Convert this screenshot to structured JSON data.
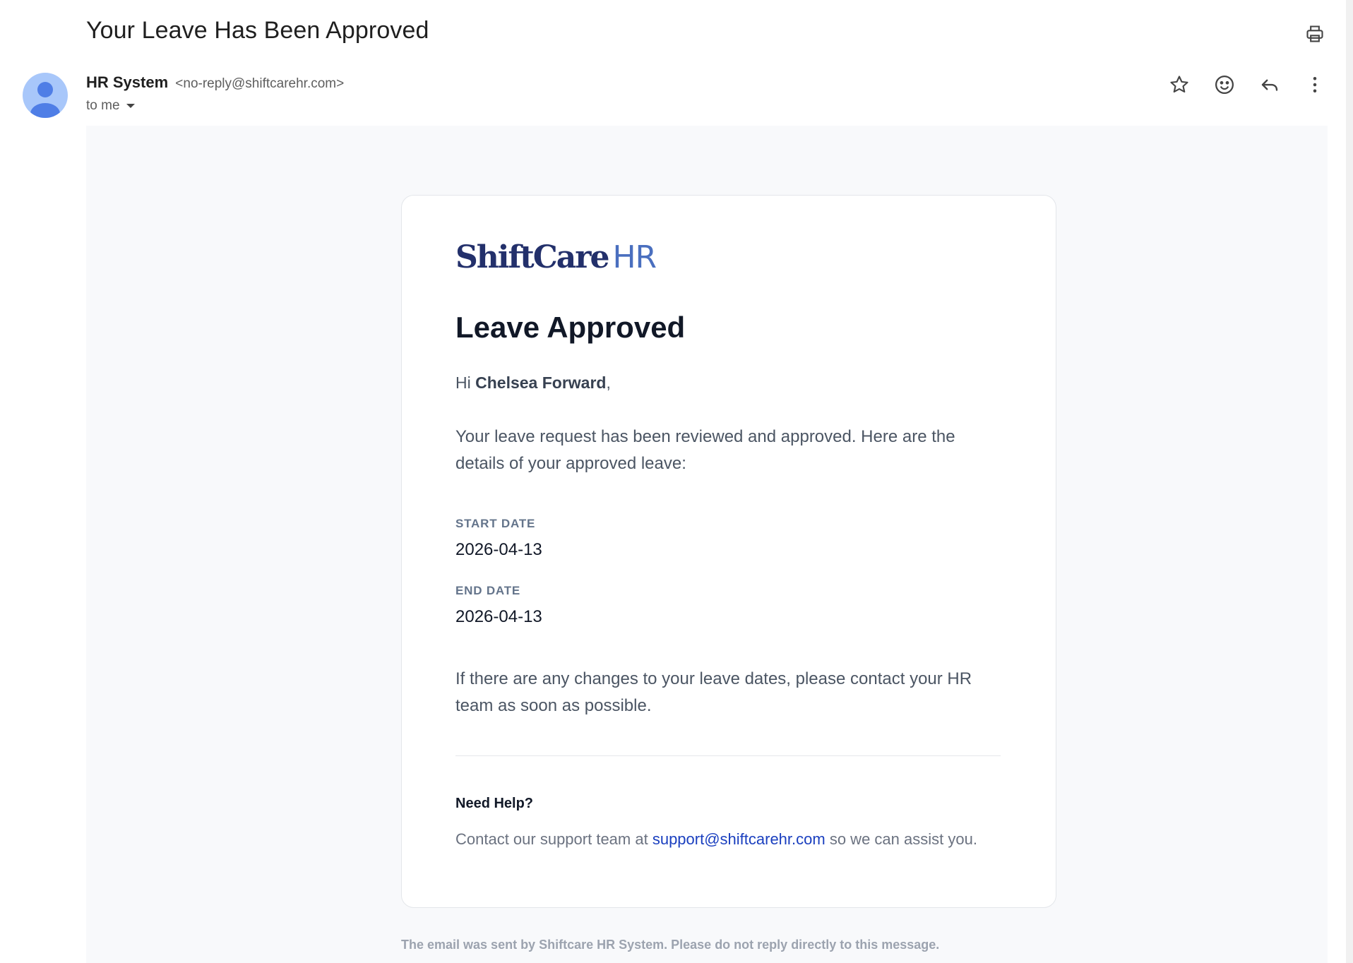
{
  "email": {
    "subject": "Your Leave Has Been Approved",
    "sender_name": "HR System",
    "sender_email": "<no-reply@shiftcarehr.com>",
    "recipient": "to me"
  },
  "icons": {
    "print": "print-icon",
    "star": "star-icon",
    "emoji": "emoji-icon",
    "reply": "reply-icon",
    "more": "more-vert-icon"
  },
  "card": {
    "logo_text": "ShiftCare",
    "logo_suffix": "HR",
    "title": "Leave Approved",
    "greeting_prefix": "Hi ",
    "employee_name": "Chelsea Forward",
    "greeting_suffix": ",",
    "intro": "Your leave request has been reviewed and approved. Here are the details of your approved leave:",
    "start_date_label": "START DATE",
    "start_date": "2026-04-13",
    "end_date_label": "END DATE",
    "end_date": "2026-04-13",
    "changes_note": "If there are any changes to your leave dates, please contact your HR team as soon as possible.",
    "help_title": "Need Help?",
    "help_prefix": "Contact our support team at ",
    "help_email": "support@shiftcarehr.com",
    "help_suffix": " so we can assist you."
  },
  "footer": {
    "note": "The email was sent by Shiftcare HR System. Please do not reply directly to this message."
  },
  "colors": {
    "brand_navy": "#23306b",
    "brand_blue": "#4a6fbf",
    "link": "#1a3fbf",
    "avatar": "#a8c7fa"
  }
}
